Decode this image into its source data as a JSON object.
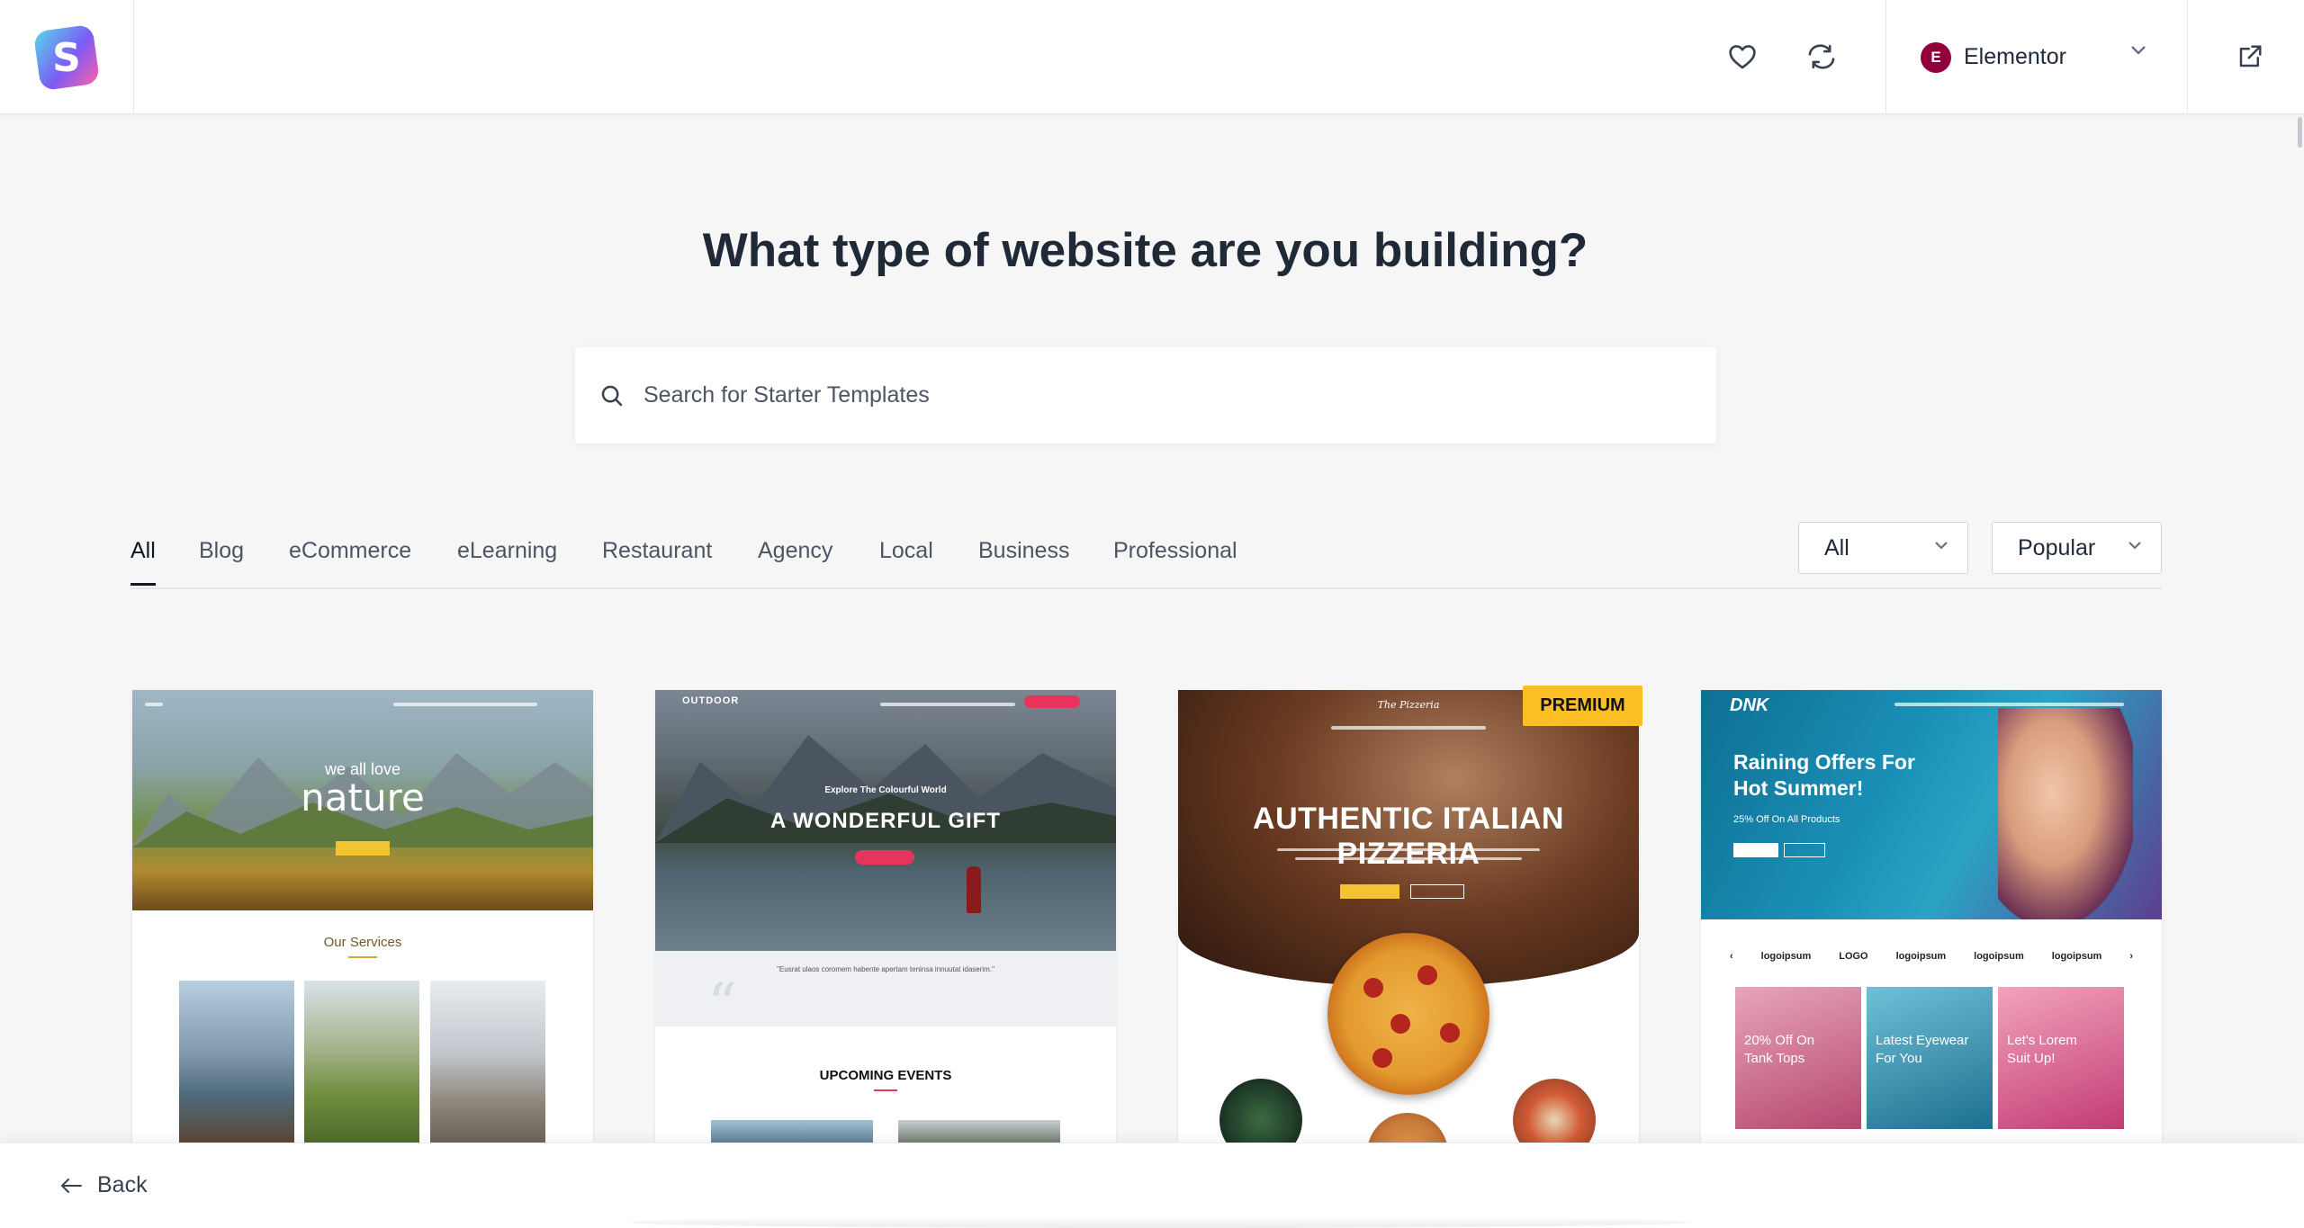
{
  "header": {
    "builder": {
      "label": "Elementor",
      "logo_letter": "E"
    },
    "icons": [
      "favorites-heart-icon",
      "sync-refresh-icon",
      "external-link-icon"
    ],
    "logo_letter": "S"
  },
  "heading": "What type of website are you building?",
  "search": {
    "placeholder": "Search for Starter Templates",
    "value": ""
  },
  "tabs": [
    {
      "label": "All",
      "active": true
    },
    {
      "label": "Blog"
    },
    {
      "label": "eCommerce"
    },
    {
      "label": "eLearning"
    },
    {
      "label": "Restaurant"
    },
    {
      "label": "Agency"
    },
    {
      "label": "Local"
    },
    {
      "label": "Business"
    },
    {
      "label": "Professional"
    }
  ],
  "filters": {
    "type": "All",
    "sort": "Popular"
  },
  "templates": [
    {
      "small": "we all love",
      "title": "nature",
      "section": "Our Services"
    },
    {
      "brand": "OUTDOOR",
      "sub": "Explore The Colourful World",
      "title": "A WONDERFUL GIFT",
      "quote": "\"Eusrat ulaos coromem habente apertam teninsa innuutat idaserim.\"",
      "section": "UPCOMING EVENTS"
    },
    {
      "badge": "PREMIUM",
      "brand": "The Pizzeria",
      "title": "AUTHENTIC ITALIAN PIZZERIA"
    },
    {
      "brand": "DNK",
      "title_line1": "Raining Offers For",
      "title_line2": "Hot Summer!",
      "sub": "25% Off On All Products",
      "logos": [
        "logoipsum",
        "LOGO",
        "logoipsum",
        "logoipsum",
        "logoipsum"
      ],
      "tiles": [
        {
          "line1": "20% Off On",
          "line2": "Tank Tops",
          "color": "#c84d79"
        },
        {
          "line1": "Latest Eyewear",
          "line2": "For You",
          "color": "#2f90b4"
        },
        {
          "line1": "Let's Lorem",
          "line2": "Suit Up!",
          "color": "#d04b86"
        }
      ]
    }
  ],
  "footer": {
    "back_label": "Back"
  },
  "colors": {
    "accent": "#111827",
    "premium": "#fbbf24",
    "elementor": "#92003b"
  }
}
